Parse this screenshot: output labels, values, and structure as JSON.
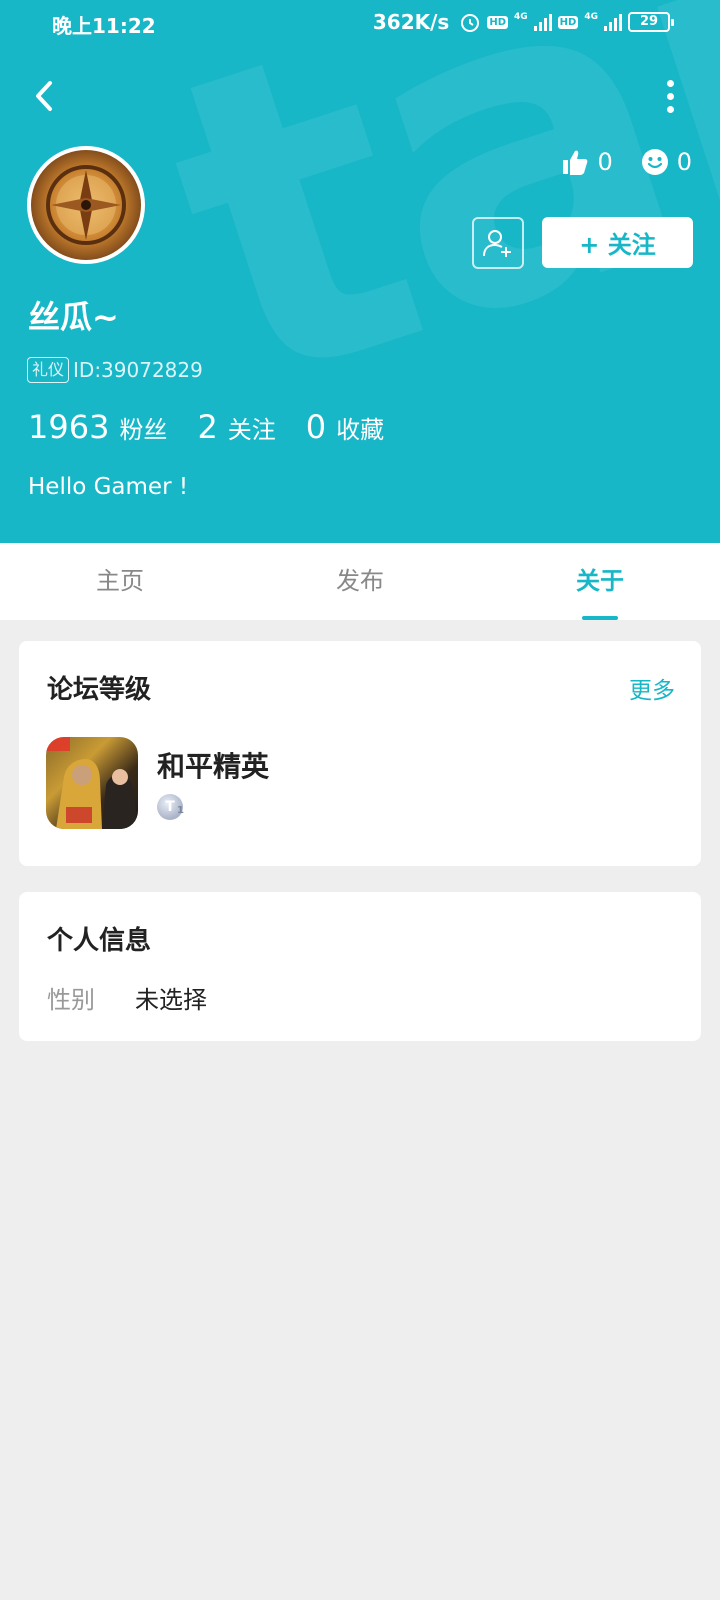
{
  "status_bar": {
    "time": "晚上11:22",
    "speed": "362K/s",
    "hd1": "HD",
    "net1": "4G",
    "hd2": "HD",
    "net2": "4G",
    "battery": "29"
  },
  "header": {
    "watermark": "tapta",
    "likes": "0",
    "smiles": "0",
    "follow_label": "+ 关注",
    "username": "丝瓜~",
    "tag": "礼仪",
    "id": "ID:39072829",
    "stats": [
      {
        "num": "1963",
        "label": "粉丝"
      },
      {
        "num": "2",
        "label": "关注"
      },
      {
        "num": "0",
        "label": "收藏"
      }
    ],
    "bio": "Hello Gamer !"
  },
  "tabs": [
    {
      "label": "主页",
      "active": false
    },
    {
      "label": "发布",
      "active": false
    },
    {
      "label": "关于",
      "active": true
    }
  ],
  "forum_card": {
    "title": "论坛等级",
    "more": "更多",
    "game_name": "和平精英",
    "level_letter": "T",
    "level_num": "1"
  },
  "info_card": {
    "title": "个人信息",
    "gender_label": "性别",
    "gender_value": "未选择"
  },
  "colors": {
    "accent": "#17b7c8",
    "background": "#eeeeee"
  },
  "icons": {
    "back": "chevron-left-icon",
    "more": "more-vertical-icon",
    "like": "thumbs-up-icon",
    "smile": "smile-icon",
    "add_friend": "add-user-icon"
  }
}
